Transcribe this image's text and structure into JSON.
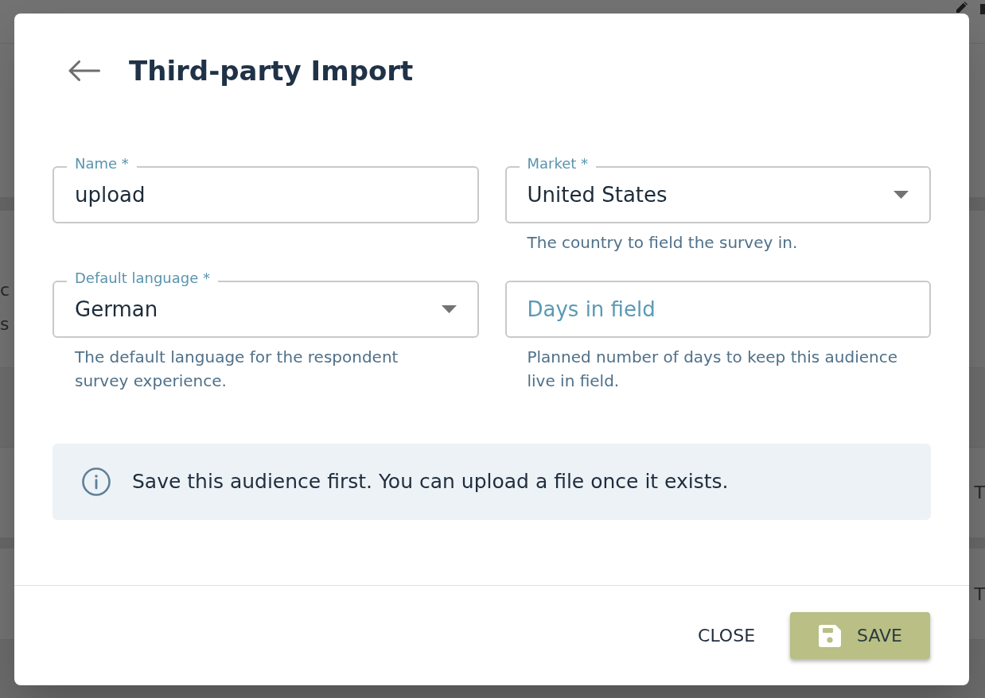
{
  "background_page": {
    "left_column": [
      "c",
      "s"
    ],
    "right_column": [
      "T",
      "T"
    ]
  },
  "dialog": {
    "title": "Third-party Import",
    "fields": [
      {
        "kind": "text",
        "label": "Name *",
        "value": "upload"
      },
      {
        "kind": "select",
        "label": "Market *",
        "value": "United States",
        "helper": "The country to field the survey in."
      },
      {
        "kind": "select",
        "label": "Default language *",
        "value": "German",
        "helper": "The default language for the respondent survey experience."
      },
      {
        "kind": "text",
        "placeholder": "Days in field",
        "helper": "Planned number of days to keep this audience live in field."
      }
    ],
    "notice": "Save this audience first. You can upload a file once it exists.",
    "buttons": [
      {
        "kind": "text",
        "label": "CLOSE"
      },
      {
        "kind": "primary",
        "label": "SAVE"
      }
    ]
  }
}
